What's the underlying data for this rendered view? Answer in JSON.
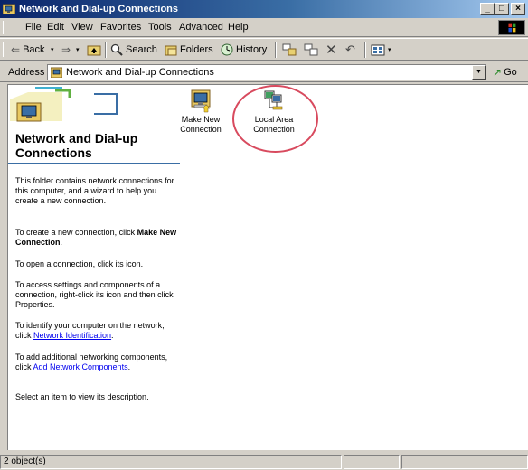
{
  "window": {
    "title": "Network and Dial-up Connections"
  },
  "caption_buttons": {
    "minimize": "_",
    "maximize": "□",
    "close": "×"
  },
  "menu": [
    "File",
    "Edit",
    "View",
    "Favorites",
    "Tools",
    "Advanced",
    "Help"
  ],
  "toolbar": {
    "back": "Back",
    "search": "Search",
    "folders": "Folders",
    "history": "History"
  },
  "address": {
    "label": "Address",
    "value": "Network and Dial-up Connections",
    "go": "Go"
  },
  "panel": {
    "title": "Network and Dial-up Connections",
    "p1": "This folder contains network connections for this computer, and a wizard to help you create a new connection.",
    "p2_pre": "To create a new connection, click ",
    "p2_bold": "Make New Connection",
    "p2_post": ".",
    "p3": "To open a connection, click its icon.",
    "p4": "To access settings and components of a connection, right-click its icon and then click Properties.",
    "p5_pre": "To identify your computer on the network, click ",
    "p5_link": "Network Identification",
    "p5_post": ".",
    "p6_pre": "To add additional networking components, click ",
    "p6_link": "Add Network Components",
    "p6_post": ".",
    "p7": "Select an item to view its description."
  },
  "items": [
    {
      "label": "Make New Connection",
      "icon": "make-new-connection-icon"
    },
    {
      "label": "Local Area Connection",
      "icon": "local-area-connection-icon"
    }
  ],
  "status": {
    "text": "2 object(s)"
  },
  "colors": {
    "title_start": "#0a246a",
    "title_end": "#a6caf0",
    "link": "#0000ee",
    "highlight": "#d84a5e",
    "face": "#d4d0c8"
  }
}
